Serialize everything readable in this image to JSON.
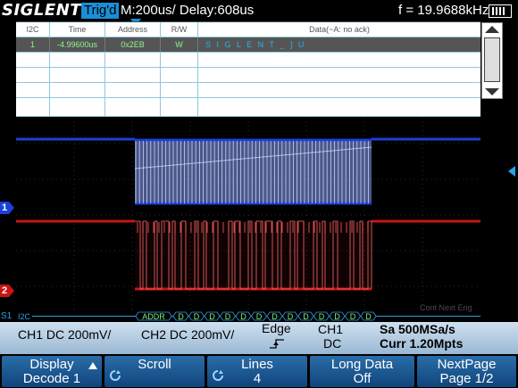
{
  "status": {
    "brand": "SIGLENT",
    "trigger_state": "Trig'd",
    "timebase": "M:200us/ Delay:608us",
    "frequency": "f = 19.9688kHz"
  },
  "decode_table": {
    "headers": [
      "I2C",
      "Time",
      "Address",
      "R/W",
      "Data(~A: no ack)"
    ],
    "rows": [
      {
        "index": "1",
        "time": "-4.99600us",
        "address": "0x2EB",
        "rw": "W",
        "data": "S I G L E N T _ ] U"
      }
    ]
  },
  "waveforms": {
    "ch1_label": "1",
    "ch2_label": "2",
    "ch1_color": "#1c3fd6",
    "ch2_color": "#c81414",
    "bus_label": "I2C",
    "bus_addr_label": "ADDR",
    "bus_data_label": "D",
    "s1_label": "S1",
    "faint_text": "Cont Next Eng"
  },
  "info_bar": {
    "ch1": "CH1 DC 200mV/",
    "ch2": "CH2 DC 200mV/",
    "trig_type": "Edge",
    "trig_source": "CH1",
    "trig_coupling": "DC",
    "sample_rate": "Sa 500MSa/s",
    "memory": "Curr 1.20Mpts"
  },
  "menu": [
    {
      "line1": "Display",
      "line2": "Decode 1"
    },
    {
      "line1": "Scroll",
      "line2": ""
    },
    {
      "line1": "Lines",
      "line2": "4"
    },
    {
      "line1": "Long Data",
      "line2": "Off"
    },
    {
      "line1": "NextPage",
      "line2": "Page 1/2"
    }
  ],
  "colors": {
    "accent": "#1a8fd6",
    "menu": "#1f5e98"
  }
}
